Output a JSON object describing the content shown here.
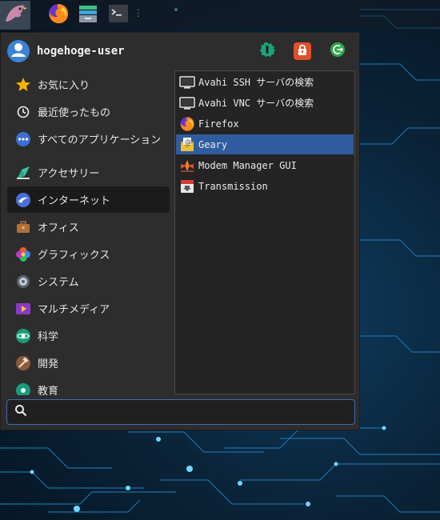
{
  "panel": {
    "icons": [
      "whisker-menu-icon",
      "firefox-icon",
      "file-manager-icon",
      "terminal-icon"
    ]
  },
  "menu": {
    "username": "hogehoge-user",
    "actions": [
      "settings-icon",
      "lock-icon",
      "logout-icon"
    ],
    "categories": [
      {
        "label": "お気に入り",
        "icon": "star-icon"
      },
      {
        "label": "最近使ったもの",
        "icon": "clock-icon"
      },
      {
        "label": "すべてのアプリケーション",
        "icon": "all-apps-icon"
      },
      {
        "label": "アクセサリー",
        "icon": "accessories-icon"
      },
      {
        "label": "インターネット",
        "icon": "internet-icon",
        "active": true
      },
      {
        "label": "オフィス",
        "icon": "office-icon"
      },
      {
        "label": "グラフィックス",
        "icon": "graphics-icon"
      },
      {
        "label": "システム",
        "icon": "system-icon"
      },
      {
        "label": "マルチメディア",
        "icon": "multimedia-icon"
      },
      {
        "label": "科学",
        "icon": "science-icon"
      },
      {
        "label": "開発",
        "icon": "development-icon"
      },
      {
        "label": "教育",
        "icon": "education-icon"
      }
    ],
    "apps": [
      {
        "label": "Avahi SSH サーバの検索",
        "icon": "network-monitor-icon"
      },
      {
        "label": "Avahi VNC サーバの検索",
        "icon": "network-monitor-icon"
      },
      {
        "label": "Firefox",
        "icon": "firefox-icon"
      },
      {
        "label": "Geary",
        "icon": "mail-icon",
        "selected": true
      },
      {
        "label": "Modem Manager GUI",
        "icon": "modem-icon"
      },
      {
        "label": "Transmission",
        "icon": "transmission-icon"
      }
    ],
    "search": {
      "value": "",
      "placeholder": ""
    }
  },
  "colors": {
    "menu_bg": "#2d2d2d",
    "selected": "#2f5c9e",
    "search_border": "#3d6db0",
    "lock": "#e0502a",
    "settings": "#1aa37a",
    "logout": "#2ea84a"
  }
}
